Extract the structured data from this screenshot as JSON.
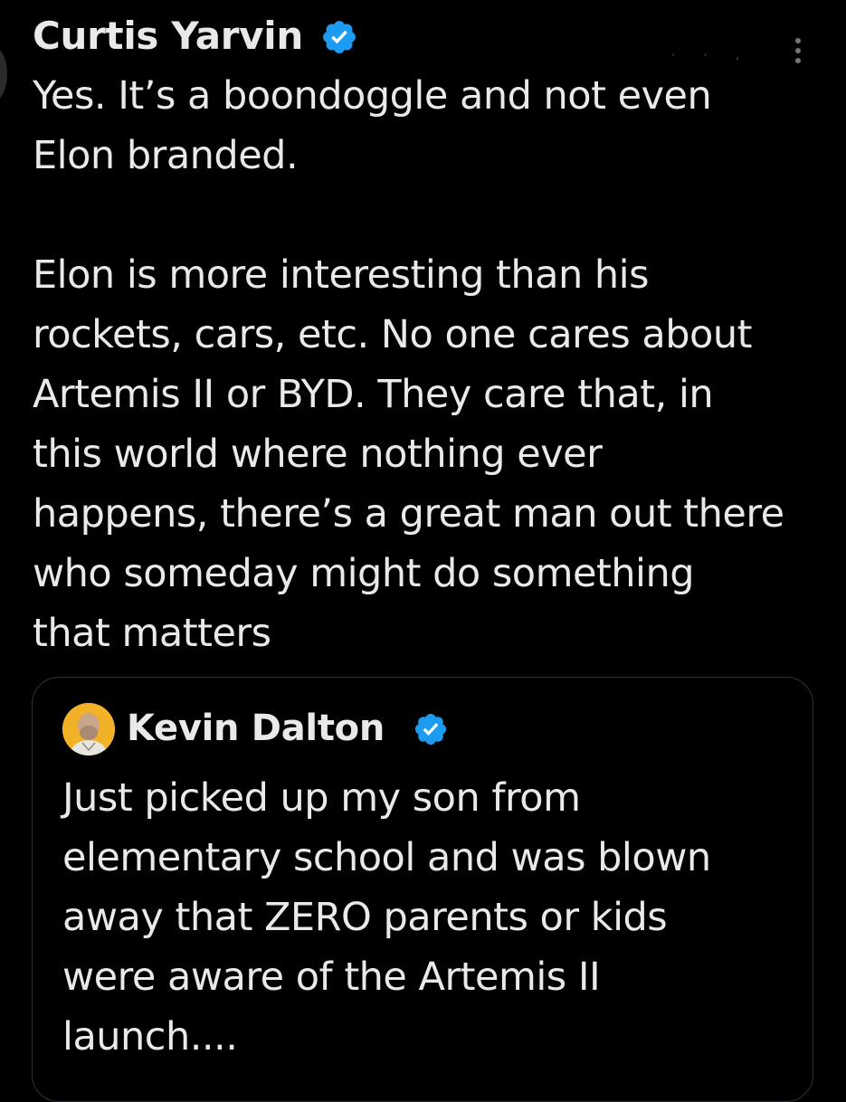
{
  "post": {
    "author_name": "Curtis Yarvin",
    "body_paragraph_1": [
      "Yes. It’s a boondoggle and not even",
      "Elon branded."
    ],
    "body_paragraph_2": [
      "Elon is more interesting than his",
      "rockets, cars, etc. No one cares about",
      "Artemis II or BYD. They care that, in",
      "this world where nothing ever",
      "happens, there’s a great man out there",
      "who someday might do something",
      "that matters"
    ]
  },
  "quoted_post": {
    "author_name": "Kevin Dalton",
    "body_lines": [
      "Just picked up my son from",
      "elementary school and was blown",
      "away that ZERO parents or kids",
      "were aware of the Artemis II",
      "launch...."
    ]
  },
  "icons": {
    "verified": "verified-badge-icon",
    "more": "more-options-icon"
  },
  "colors": {
    "background": "#000000",
    "text": "#e7e9ea",
    "verified_blue": "#1d9bf0",
    "border": "#2f3336",
    "muted": "#71767b"
  }
}
